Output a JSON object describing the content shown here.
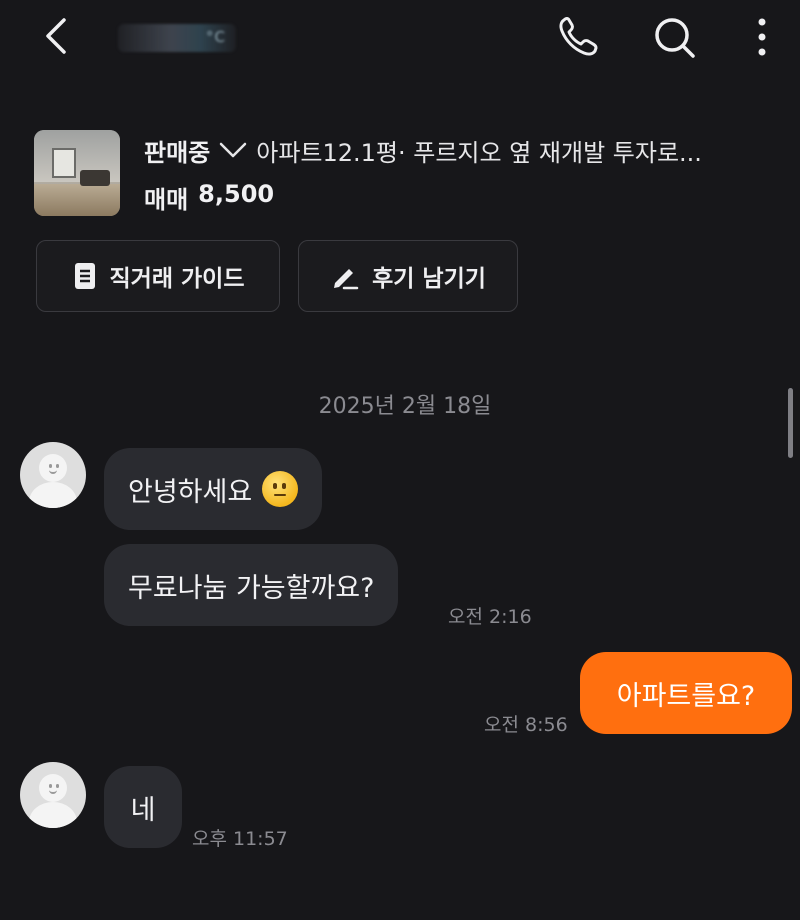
{
  "header": {
    "back_icon": "chevron-left-icon",
    "title_blurred": "°C",
    "icons": [
      "phone-icon",
      "search-icon",
      "more-vertical-icon"
    ]
  },
  "product": {
    "status": "판매중",
    "title": "아파트12.1평· 푸르지오 옆 재개발 투자로...",
    "price_label": "매매",
    "price_value": "8,500"
  },
  "actions": {
    "guide_label": "직거래 가이드",
    "review_label": "후기 남기기"
  },
  "chat": {
    "date": "2025년 2월 18일",
    "messages": [
      {
        "from": "other",
        "text": "안녕하세요"
      },
      {
        "from": "other",
        "text": "무료나눔 가능할까요?",
        "time": "오전 2:16"
      },
      {
        "from": "me",
        "text": "아파트를요?",
        "time": "오전 8:56"
      },
      {
        "from": "other",
        "text": "네",
        "time": "오후 11:57"
      }
    ]
  },
  "colors": {
    "background": "#17171a",
    "bubble_other": "#2a2b30",
    "bubble_mine": "#ff6f0f",
    "meta_text": "#8b8b91"
  }
}
